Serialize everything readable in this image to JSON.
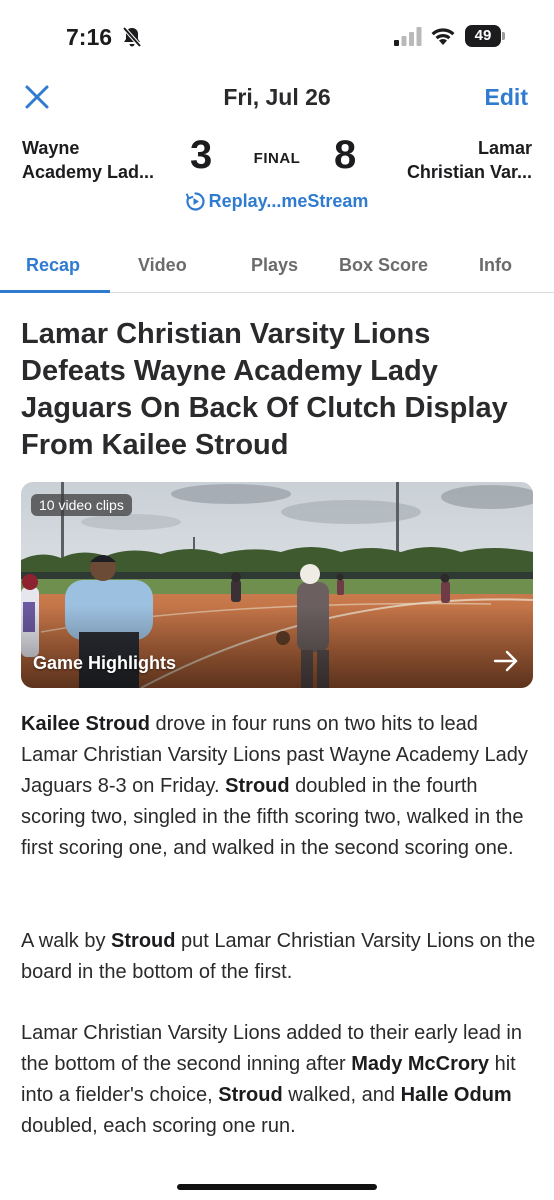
{
  "status_bar": {
    "time": "7:16",
    "battery": "49",
    "icons": [
      "bell-slash-icon",
      "signal-icon",
      "wifi-icon",
      "battery-icon"
    ]
  },
  "nav": {
    "date": "Fri, Jul 26",
    "edit_label": "Edit",
    "close_icon": "close-icon"
  },
  "game": {
    "home_team": "Wayne\nAcademy Lad...",
    "home_score": "3",
    "status": "FINAL",
    "away_score": "8",
    "away_team": "Lamar\nChristian Var...",
    "replay_label": "Replay...meStream"
  },
  "tabs": [
    {
      "label": "Recap",
      "active": true
    },
    {
      "label": "Video",
      "active": false
    },
    {
      "label": "Plays",
      "active": false
    },
    {
      "label": "Box Score",
      "active": false
    },
    {
      "label": "Info",
      "active": false
    }
  ],
  "article": {
    "headline": "Lamar Christian Varsity Lions Defeats Wayne Academy Lady Jaguars On Back Of Clutch Display From Kailee Stroud",
    "video": {
      "clips": "10 video clips",
      "title": "Game Highlights"
    },
    "p1": {
      "b1": "Kailee Stroud",
      "t1": " drove in four runs on two hits to lead Lamar Christian Varsity Lions past Wayne Academy Lady Jaguars 8-3 on Friday. ",
      "b2": "Stroud",
      "t2": " doubled in the fourth scoring two, singled in the fifth scoring two, walked in the first scoring one, and walked in the second scoring one."
    },
    "p2": {
      "t1": "A walk by ",
      "b1": "Stroud",
      "t2": " put Lamar Christian Varsity Lions on the board in the bottom of the first."
    },
    "p3": {
      "t1": "Lamar Christian Varsity Lions added to their early lead in the bottom of the second inning after ",
      "b1": "Mady McCrory",
      "t2": " hit into a fielder's choice, ",
      "b2": "Stroud",
      "t3": " walked, and ",
      "b3": "Halle Odum",
      "t4": " doubled, each scoring one run."
    }
  },
  "colors": {
    "accent": "#2f7bd0",
    "text": "#2a2a2c",
    "tab_inactive": "#6b6b6b"
  }
}
